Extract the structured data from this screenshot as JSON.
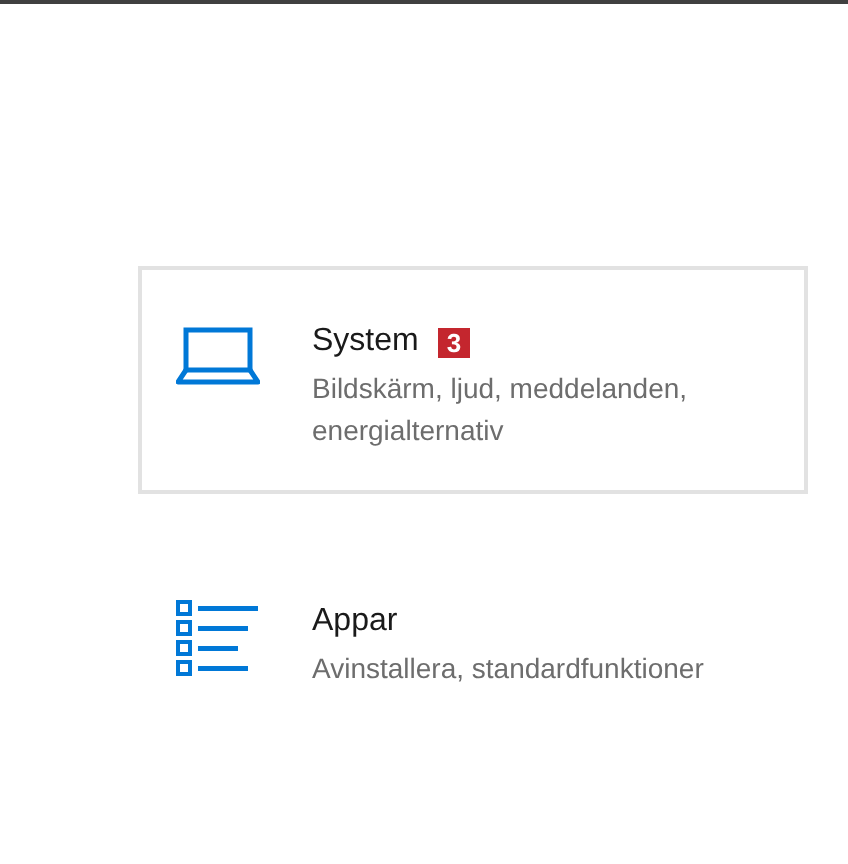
{
  "categories": [
    {
      "kind": "laptop",
      "title": "System",
      "badge": "3",
      "description": "Bildskärm, ljud, meddelanden, energialternativ",
      "selected": true
    },
    {
      "kind": "list",
      "title": "Appar",
      "description": "Avinstallera, standardfunktioner",
      "selected": false
    }
  ]
}
